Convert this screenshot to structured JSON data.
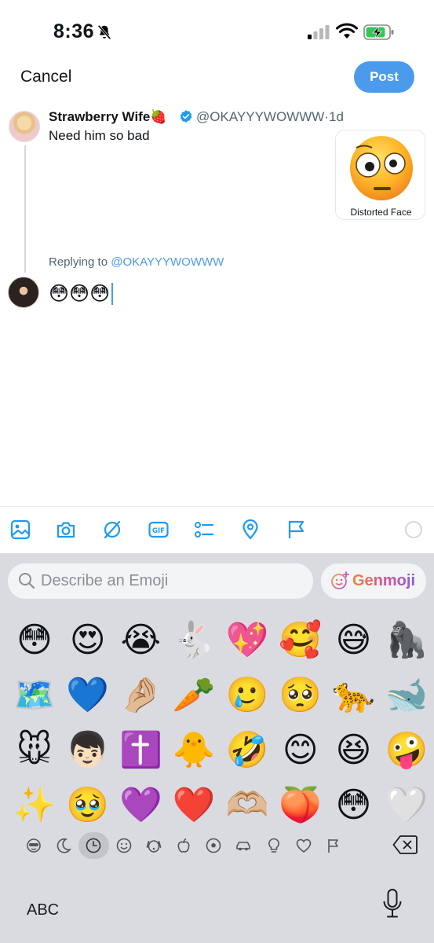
{
  "status_bar": {
    "time": "8:36",
    "icons": [
      "bell-slash-icon",
      "cellular-signal-icon",
      "wifi-icon",
      "battery-charging-icon"
    ]
  },
  "header": {
    "cancel_label": "Cancel",
    "post_label": "Post"
  },
  "quoted_tweet": {
    "author_name": "Strawberry Wife🍓",
    "handle": "@OKAYYYWOWWW",
    "separator": "·",
    "age": "1d",
    "text": "Need him so bad",
    "media_caption": "Distorted Face"
  },
  "reply": {
    "replying_prefix": "Replying to",
    "replying_handle": "@OKAYYYWOWWW",
    "draft_text": "😳😳😳"
  },
  "toolbar": {
    "icons": [
      "image-icon",
      "camera-icon",
      "grok-icon",
      "gif-icon",
      "poll-icon",
      "location-icon",
      "flag-icon",
      "character-count-ring"
    ]
  },
  "keyboard": {
    "search_placeholder": "Describe an Emoji",
    "genmoji_label": "Genmoji",
    "emojis": [
      "😳",
      "😍",
      "😭",
      "🐇",
      "💖",
      "🥰",
      "😅",
      "🦍",
      "🗺️",
      "💙",
      "🤌🏼",
      "🥕",
      "🥲",
      "🥺",
      "🐆",
      "🐋",
      "🐭",
      "👦🏻",
      "✝️",
      "🐥",
      "🤣",
      "😊",
      "😆",
      "🤪",
      "✨",
      "🥹",
      "💜",
      "❤️",
      "🫶🏼",
      "🍑",
      "😳",
      "🤍"
    ],
    "categories": [
      "smileys-people-mask-icon",
      "moon-sticker-icon",
      "recent-clock-icon",
      "smiley-icon",
      "dog-icon",
      "apple-icon",
      "soccer-ball-icon",
      "car-icon",
      "lightbulb-icon",
      "heart-icon",
      "flag-outline-icon"
    ],
    "active_category_index": 2,
    "abc_label": "ABC"
  }
}
